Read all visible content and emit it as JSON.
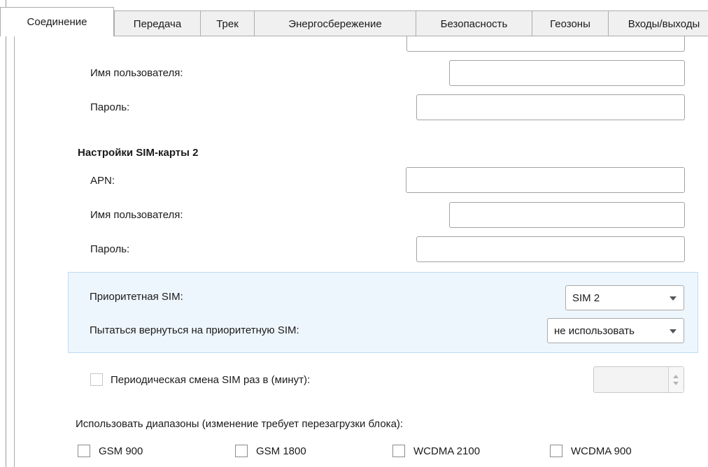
{
  "tabs": [
    "Соединение",
    "Передача",
    "Трек",
    "Энергосбережение",
    "Безопасность",
    "Геозоны",
    "Входы/выходы"
  ],
  "sim1": {
    "username_label": "Имя пользователя:",
    "password_label": "Пароль:",
    "username_value": "",
    "password_value": ""
  },
  "sim2": {
    "heading": "Настройки SIM-карты 2",
    "apn_label": "APN:",
    "username_label": "Имя пользователя:",
    "password_label": "Пароль:",
    "apn_value": "",
    "username_value": "",
    "password_value": ""
  },
  "priority": {
    "priority_sim_label": "Приоритетная SIM:",
    "priority_sim_value": "SIM 2",
    "return_label": "Пытаться вернуться на приоритетную SIM:",
    "return_value": "не использовать"
  },
  "periodic": {
    "label": "Периодическая смена SIM раз в (минут):",
    "checked": false,
    "value": ""
  },
  "bands": {
    "label": "Использовать диапазоны (изменение требует перезагрузки блока):",
    "items": [
      {
        "label": "GSM 900",
        "checked": false
      },
      {
        "label": "GSM 1800",
        "checked": false
      },
      {
        "label": "WCDMA 2100",
        "checked": false
      },
      {
        "label": "WCDMA 900",
        "checked": false
      }
    ]
  }
}
